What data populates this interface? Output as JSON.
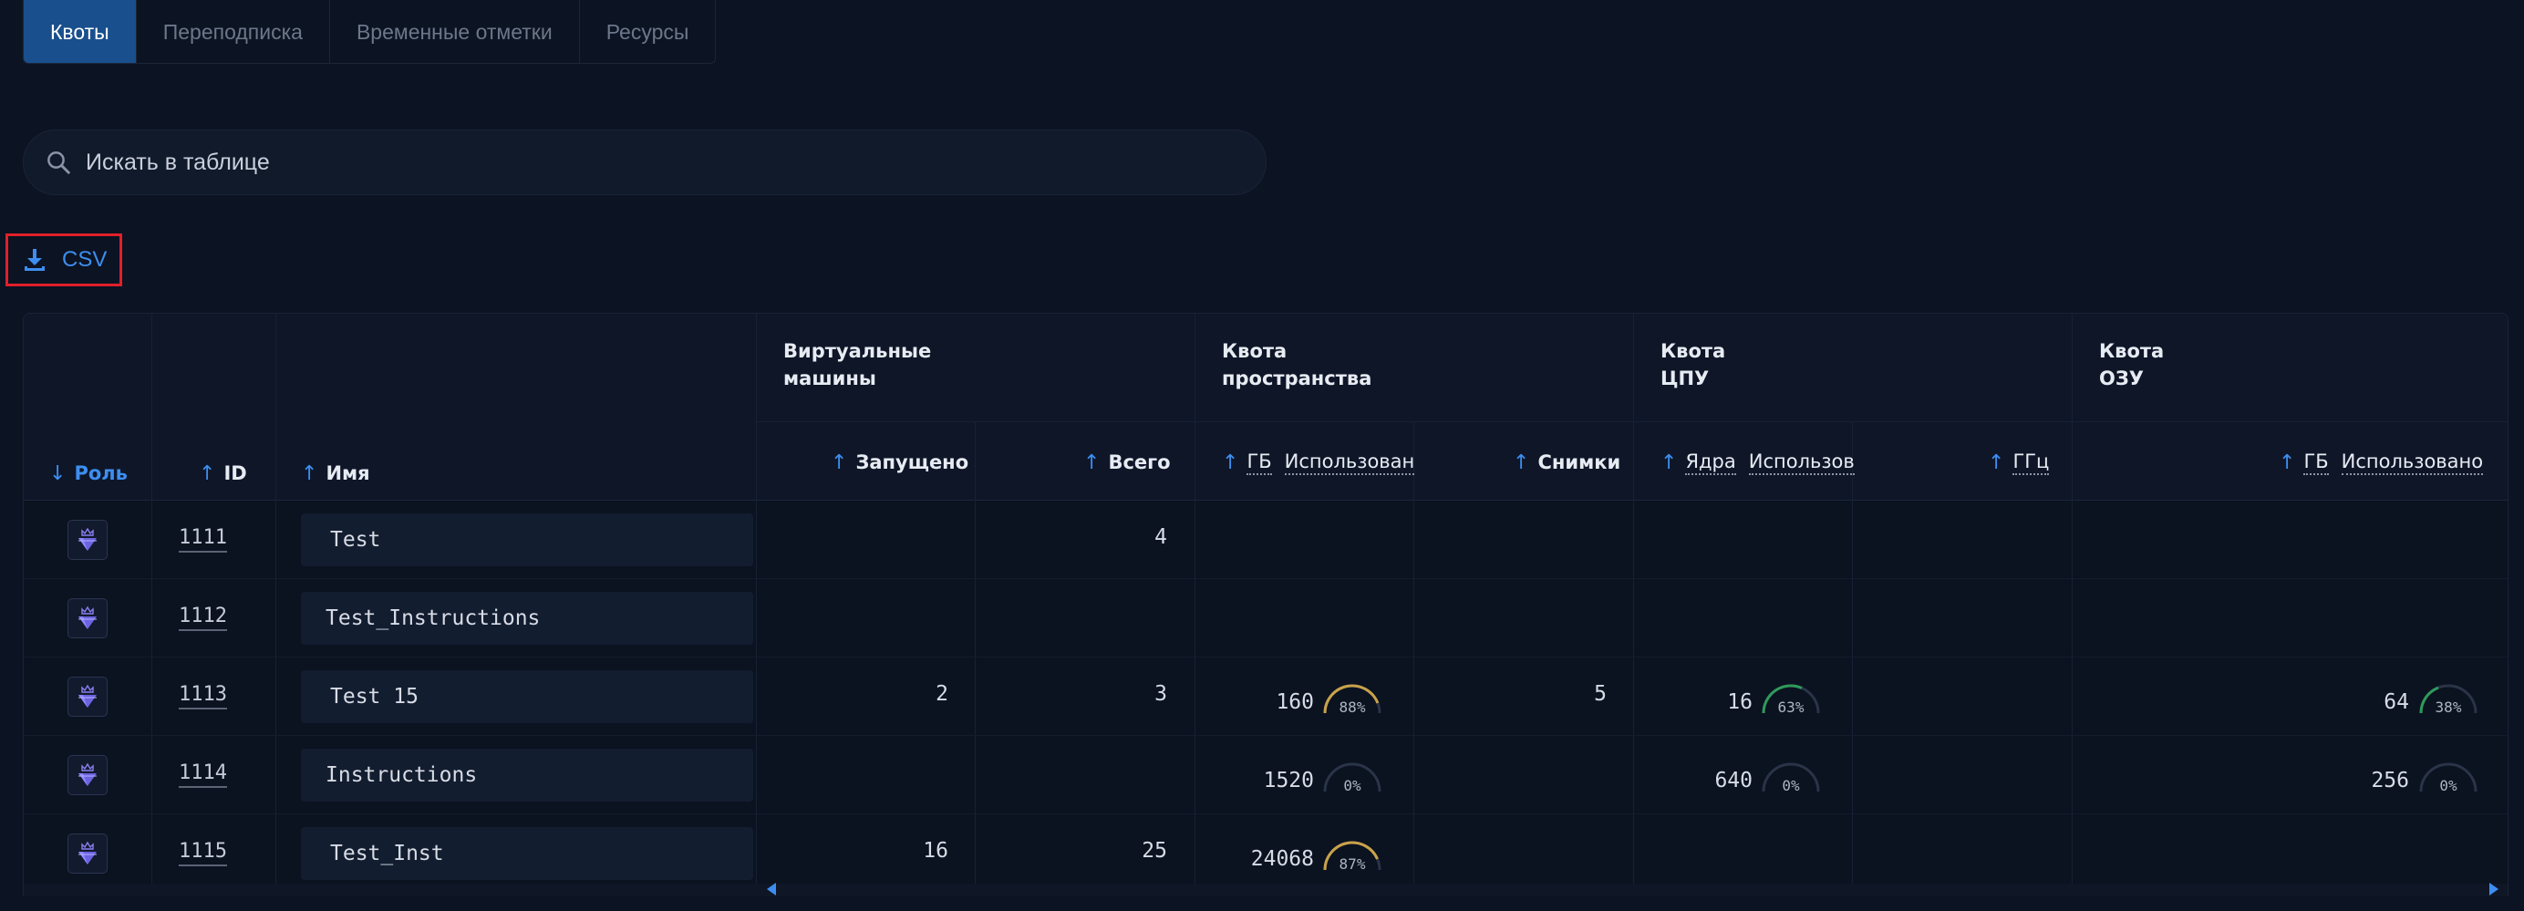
{
  "tabs": [
    {
      "label": "Квоты",
      "active": true
    },
    {
      "label": "Переподписка",
      "active": false
    },
    {
      "label": "Временные отметки",
      "active": false
    },
    {
      "label": "Ресурсы",
      "active": false
    }
  ],
  "search": {
    "placeholder": "Искать в таблице"
  },
  "csv_label": "CSV",
  "table": {
    "columns": {
      "role": "Роль",
      "id": "ID",
      "name": "Имя",
      "started": "Запущено",
      "total": "Всего",
      "space_gb": "ГБ",
      "space_used": "Использован",
      "snapshots": "Снимки",
      "cpu_cores": "Ядра",
      "cpu_used": "Использов",
      "cpu_ghz": "ГГц",
      "ram_gb": "ГБ",
      "ram_used": "Использовано"
    },
    "groups": {
      "vm": [
        "Виртуальные",
        "машины"
      ],
      "space": [
        "Квота",
        "пространства"
      ],
      "cpu": [
        "Квота",
        "ЦПУ"
      ],
      "ram": [
        "Квота",
        "ОЗУ"
      ]
    },
    "rows": [
      {
        "id": "1111",
        "name": "Test",
        "started": "",
        "total": "4",
        "space_gb": "",
        "space_pct": null,
        "snapshots": "",
        "cpu_cores": "",
        "cpu_pct": null,
        "ram_gb": "",
        "ram_pct": null
      },
      {
        "id": "1112",
        "name": "Test_Instructions",
        "started": "",
        "total": "",
        "space_gb": "",
        "space_pct": null,
        "snapshots": "",
        "cpu_cores": "",
        "cpu_pct": null,
        "ram_gb": "",
        "ram_pct": null
      },
      {
        "id": "1113",
        "name": "Test 15",
        "started": "2",
        "total": "3",
        "space_gb": "160",
        "space_pct": "88%",
        "snapshots": "5",
        "cpu_cores": "16",
        "cpu_pct": "63%",
        "ram_gb": "64",
        "ram_pct": "38%"
      },
      {
        "id": "1114",
        "name": "Instructions",
        "started": "",
        "total": "",
        "space_gb": "1520",
        "space_pct": "0%",
        "snapshots": "",
        "cpu_cores": "640",
        "cpu_pct": "0%",
        "ram_gb": "256",
        "ram_pct": "0%"
      },
      {
        "id": "1115",
        "name": "Test_Inst",
        "started": "16",
        "total": "25",
        "space_gb": "24068",
        "space_pct": "87%",
        "snapshots": "",
        "cpu_cores": "",
        "cpu_pct": null,
        "ram_gb": "",
        "ram_pct": null
      }
    ]
  },
  "colors": {
    "accent": "#3d8ef0",
    "tab_active": "#1a4f8d",
    "gauge_gold": "#c9a24a",
    "gauge_green": "#2f9a5a",
    "gauge_empty": "#2a3448",
    "csv_highlight": "#e0202a"
  },
  "icons": {
    "search": "search-icon",
    "download": "download-icon",
    "role": "diamond-crown-icon",
    "sort": "arrow-up-icon"
  }
}
